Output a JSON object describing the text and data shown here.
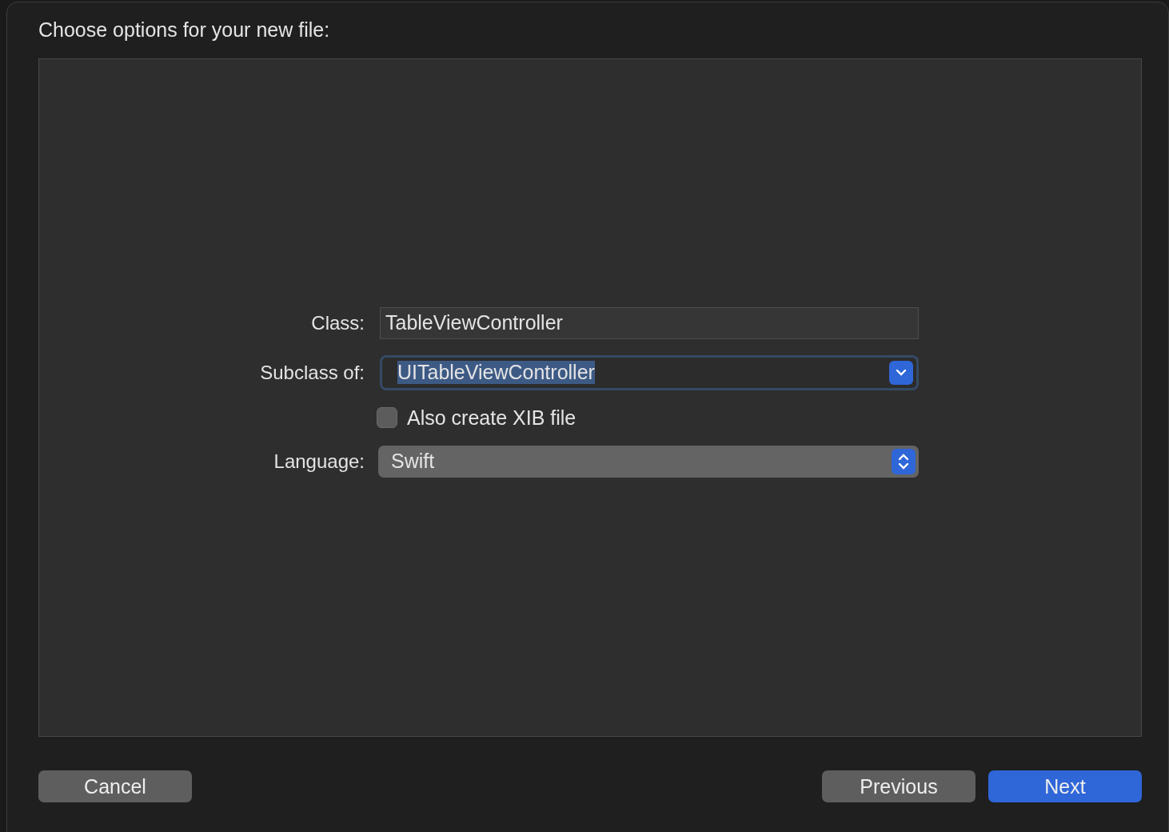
{
  "dialog": {
    "title": "Choose options for your new file:"
  },
  "form": [
    {
      "kind": "text",
      "label": "Class:",
      "value": "TableViewController"
    },
    {
      "kind": "combo",
      "label": "Subclass of:",
      "value": "UITableViewController",
      "focused": true
    },
    {
      "kind": "checkbox",
      "label": "Also create XIB file",
      "checked": false
    },
    {
      "kind": "popup",
      "label": "Language:",
      "value": "Swift"
    }
  ],
  "left_buttons": [
    {
      "label": "Cancel",
      "primary": false
    }
  ],
  "right_buttons": [
    {
      "label": "Previous",
      "primary": false
    },
    {
      "label": "Next",
      "primary": true
    }
  ]
}
